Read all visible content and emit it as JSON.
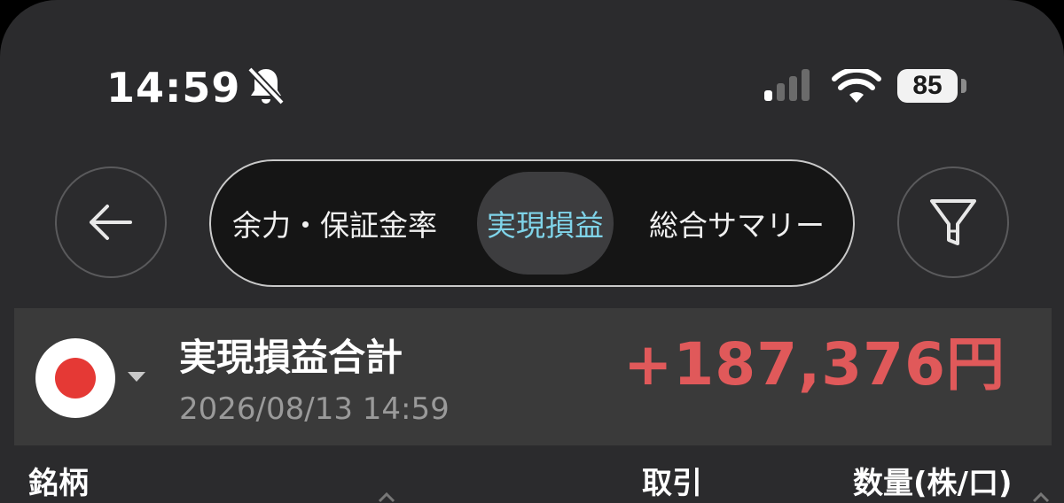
{
  "status_bar": {
    "time": "14:59",
    "battery": "85",
    "icons": [
      "bell-slash-icon",
      "cellular-signal-icon",
      "wifi-icon",
      "battery-icon"
    ]
  },
  "nav": {
    "back_icon": "arrow-left-icon",
    "filter_icon": "funnel-icon",
    "tabs": [
      {
        "label": "余力・保証金率"
      },
      {
        "label": "実現損益",
        "selected": true
      },
      {
        "label": "総合サマリー"
      }
    ]
  },
  "summary": {
    "flag_icon": "japan-flag-icon",
    "title": "実現損益合計",
    "date": "2026/08/13 14:59",
    "amount": "+187,376円",
    "amount_color": "#e0595a"
  },
  "table": {
    "headers": [
      "銘柄",
      "取引",
      "数量(株/口)"
    ]
  },
  "colors": {
    "background": "#2b2b2d",
    "card": "#3a3a3a",
    "accent": "#7fd3e8"
  }
}
